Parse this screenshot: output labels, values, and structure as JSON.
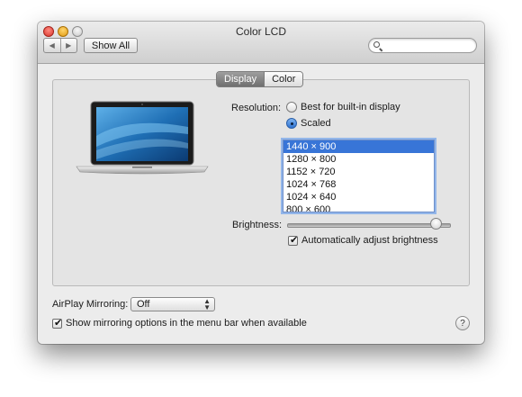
{
  "window": {
    "title": "Color LCD"
  },
  "toolbar": {
    "back_icon": "chevron-left-icon",
    "forward_icon": "chevron-right-icon",
    "back_glyph": "◀",
    "forward_glyph": "▶",
    "show_all_label": "Show All",
    "search_placeholder": ""
  },
  "tabs": [
    {
      "label": "Display",
      "active": true
    },
    {
      "label": "Color",
      "active": false
    }
  ],
  "display": {
    "resolution_label": "Resolution:",
    "options": [
      {
        "label": "Best for built-in display",
        "selected": false
      },
      {
        "label": "Scaled",
        "selected": true
      }
    ],
    "resolutions": [
      "1440 × 900",
      "1280 × 800",
      "1152 × 720",
      "1024 × 768",
      "1024 × 640",
      "800 × 600"
    ],
    "selected_resolution": "1440 × 900",
    "brightness_label": "Brightness:",
    "brightness_level": 0.91,
    "auto_brightness_label": "Automatically adjust brightness",
    "auto_brightness_checked": true
  },
  "airplay": {
    "label": "AirPlay Mirroring:",
    "value": "Off",
    "show_mirroring_label": "Show mirroring options in the menu bar when available",
    "show_mirroring_checked": true
  },
  "help": {
    "glyph": "?"
  },
  "colors": {
    "selection": "#3875d7",
    "accent": "#2f73d3"
  }
}
